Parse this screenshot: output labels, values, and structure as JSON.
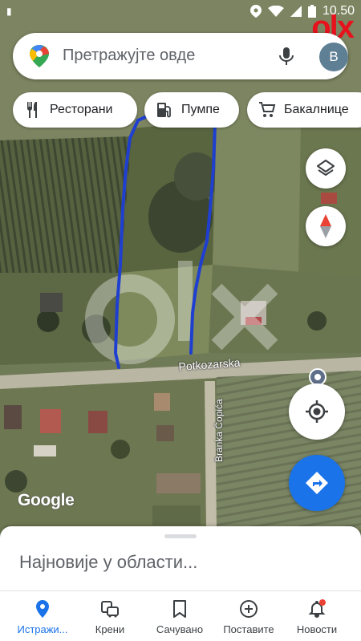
{
  "status_bar": {
    "time": "10.50",
    "icons": [
      "location-icon",
      "wifi-icon",
      "signal-icon",
      "battery-icon"
    ]
  },
  "watermark": {
    "logo_text": "olx",
    "brand_color": "#e6121c"
  },
  "search": {
    "placeholder": "Претражујте овде",
    "avatar_letter": "B"
  },
  "chips": [
    {
      "label": "Ресторани",
      "icon": "restaurant-icon"
    },
    {
      "label": "Пумпе",
      "icon": "gas-station-icon"
    },
    {
      "label": "Бакалнице",
      "icon": "shopping-cart-icon"
    }
  ],
  "map": {
    "road_horizontal": "Potkozarska",
    "road_vertical": "Branka Ćopića",
    "attribution": "Google",
    "drawn_boundary_color": "#1f3fd0"
  },
  "sheet": {
    "title": "Најновије у области..."
  },
  "nav": [
    {
      "label": "Истражи...",
      "icon": "explore-pin-icon",
      "active": true
    },
    {
      "label": "Крени",
      "icon": "commute-icon",
      "active": false
    },
    {
      "label": "Сачувано",
      "icon": "bookmark-icon",
      "active": false
    },
    {
      "label": "Поставите",
      "icon": "add-circle-icon",
      "active": false
    },
    {
      "label": "Новости",
      "icon": "bell-icon",
      "active": false
    }
  ],
  "colors": {
    "accent": "#1a73e8",
    "notification_dot": "#ea4335"
  }
}
